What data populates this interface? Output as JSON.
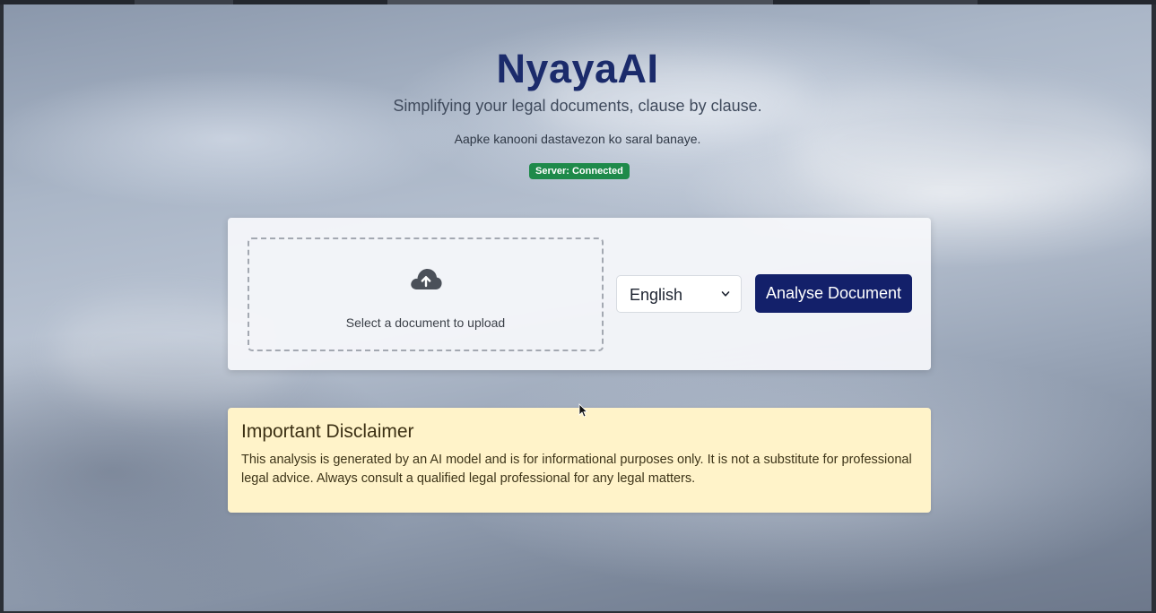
{
  "header": {
    "title": "NyayaAI",
    "tagline": "Simplifying your legal documents, clause by clause.",
    "tagline_hinglish": "Aapke kanooni dastavezon ko saral banaye.",
    "server_status": "Server: Connected"
  },
  "upload": {
    "dropzone_label": "Select a document to upload",
    "dropzone_icon": "cloud-upload-icon",
    "language": "English",
    "analyse_label": "Analyse Document"
  },
  "disclaimer": {
    "title": "Important Disclaimer",
    "text": "This analysis is generated by an AI model and is for informational purposes only. It is not a substitute for professional legal advice. Always consult a qualified legal professional for any legal matters."
  },
  "colors": {
    "title": "#1b2b6b",
    "button": "#13206a",
    "badge": "#1e8a4a",
    "disclaimer_bg": "#fff3c9"
  }
}
